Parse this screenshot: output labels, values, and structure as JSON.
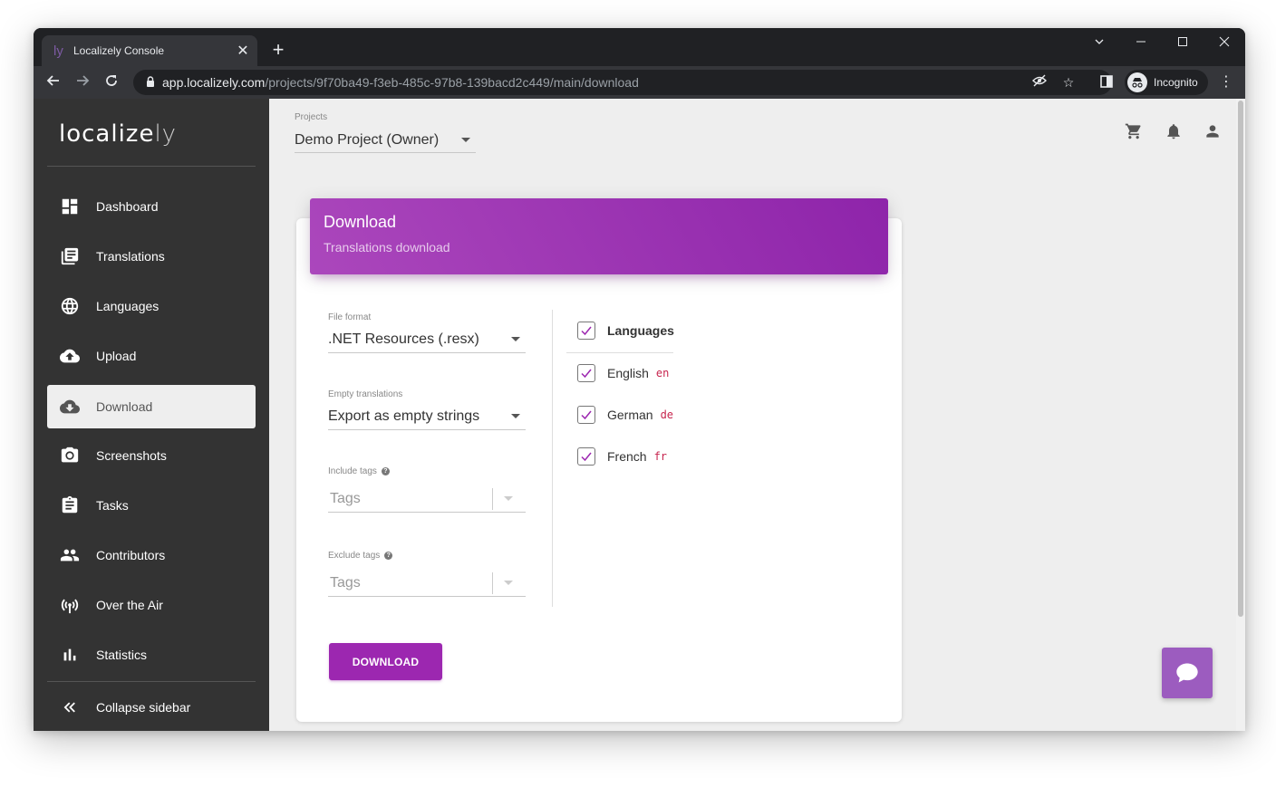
{
  "browser": {
    "tab_title": "Localizely Console",
    "tab_favicon": "ly",
    "url_host": "app.localizely.com",
    "url_path": "/projects/9f70ba49-f3eb-485c-97b8-139bacd2c449/main/download",
    "incognito_label": "Incognito"
  },
  "sidebar": {
    "logo_main": "localize",
    "logo_light": "ly",
    "items": [
      {
        "label": "Dashboard",
        "icon": "dashboard-icon"
      },
      {
        "label": "Translations",
        "icon": "translations-icon"
      },
      {
        "label": "Languages",
        "icon": "globe-icon"
      },
      {
        "label": "Upload",
        "icon": "cloud-upload-icon"
      },
      {
        "label": "Download",
        "icon": "cloud-download-icon",
        "active": true
      },
      {
        "label": "Screenshots",
        "icon": "camera-icon"
      },
      {
        "label": "Tasks",
        "icon": "clipboard-icon"
      },
      {
        "label": "Contributors",
        "icon": "people-icon"
      },
      {
        "label": "Over the Air",
        "icon": "antenna-icon"
      },
      {
        "label": "Statistics",
        "icon": "bar-chart-icon"
      }
    ],
    "collapse_label": "Collapse sidebar"
  },
  "header": {
    "projects_label": "Projects",
    "project_value": "Demo Project (Owner)"
  },
  "card": {
    "title": "Download",
    "subtitle": "Translations download",
    "file_format_label": "File format",
    "file_format_value": ".NET Resources (.resx)",
    "empty_translations_label": "Empty translations",
    "empty_translations_value": "Export as empty strings",
    "include_tags_label": "Include tags",
    "include_tags_placeholder": "Tags",
    "exclude_tags_label": "Exclude tags",
    "exclude_tags_placeholder": "Tags",
    "languages_header": "Languages",
    "languages": [
      {
        "name": "English",
        "code": "en",
        "checked": true
      },
      {
        "name": "German",
        "code": "de",
        "checked": true
      },
      {
        "name": "French",
        "code": "fr",
        "checked": true
      }
    ],
    "download_button": "DOWNLOAD"
  },
  "colors": {
    "accent": "#9c27b0",
    "sidebar_bg": "#333333",
    "code": "#c7254e"
  }
}
